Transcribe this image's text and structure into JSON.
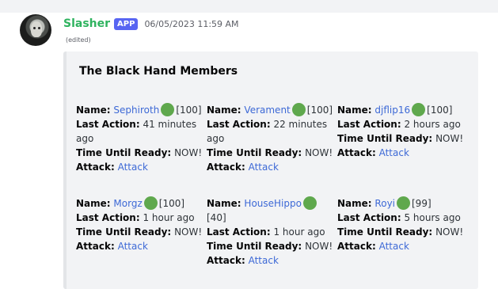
{
  "message": {
    "author": "Slasher",
    "badge": "APP",
    "timestamp": "06/05/2023 11:59 AM",
    "edited": "(edited)"
  },
  "embed": {
    "title": "The Black Hand Members",
    "labels": {
      "name": "Name:",
      "last_action": "Last Action:",
      "time_until_ready": "Time Until Ready:",
      "attack": "Attack:"
    },
    "members": [
      {
        "name": "Sephiroth",
        "status": "green-circle",
        "level": "[100]",
        "last_action": "41 minutes ago",
        "ready": "NOW!",
        "attack": "Attack"
      },
      {
        "name": "Verament",
        "status": "green-circle",
        "level": "[100]",
        "last_action": "22 minutes ago",
        "ready": "NOW!",
        "attack": "Attack"
      },
      {
        "name": "djflip16",
        "status": "green-circle",
        "level": "[100]",
        "last_action": "2 hours ago",
        "ready": "NOW!",
        "attack": "Attack"
      },
      {
        "name": "Morgz",
        "status": "green-circle",
        "level": "[100]",
        "last_action": "1 hour ago",
        "ready": "NOW!",
        "attack": "Attack"
      },
      {
        "name": "HouseHippo",
        "status": "green-circle",
        "level": "[40]",
        "last_action": "1 hour ago",
        "ready": "NOW!",
        "attack": "Attack"
      },
      {
        "name": "Royi",
        "status": "green-circle",
        "level": "[99]",
        "last_action": "5 hours ago",
        "ready": "NOW!",
        "attack": "Attack"
      }
    ]
  },
  "colors": {
    "author": "#2fb35f",
    "badge_bg": "#5865f2",
    "link": "#3d69d6",
    "status_online": "#5fa84d",
    "embed_bg": "#f2f3f5"
  }
}
